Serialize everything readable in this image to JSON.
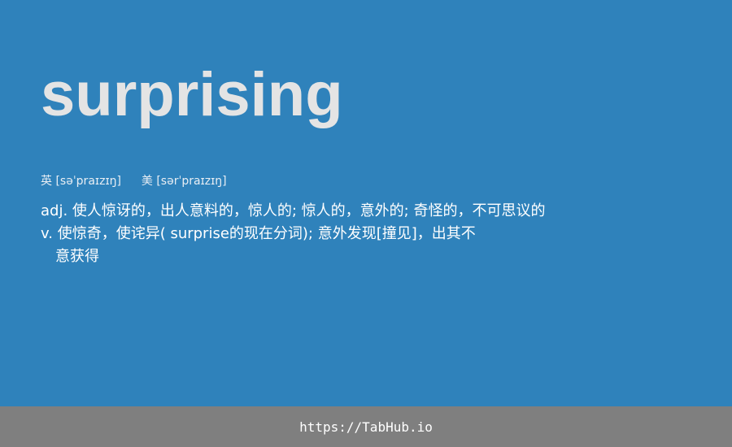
{
  "word": "surprising",
  "phonetics": {
    "uk_label": "英",
    "uk_ipa": "[səˈpraɪzɪŋ]",
    "us_label": "美",
    "us_ipa": "[sərˈpraɪzɪŋ]"
  },
  "definitions": {
    "adj": "adj. 使人惊讶的，出人意料的，惊人的; 惊人的，意外的; 奇怪的，不可思议的",
    "v_line1": "v. 使惊奇，使诧异( surprise的现在分词); 意外发现[撞见]，出其不",
    "v_line2": "意获得"
  },
  "footer": {
    "url": "https://TabHub.io"
  },
  "colors": {
    "background": "#2f82bb",
    "footer": "#7f7f7f",
    "word": "#e4e4e4"
  }
}
